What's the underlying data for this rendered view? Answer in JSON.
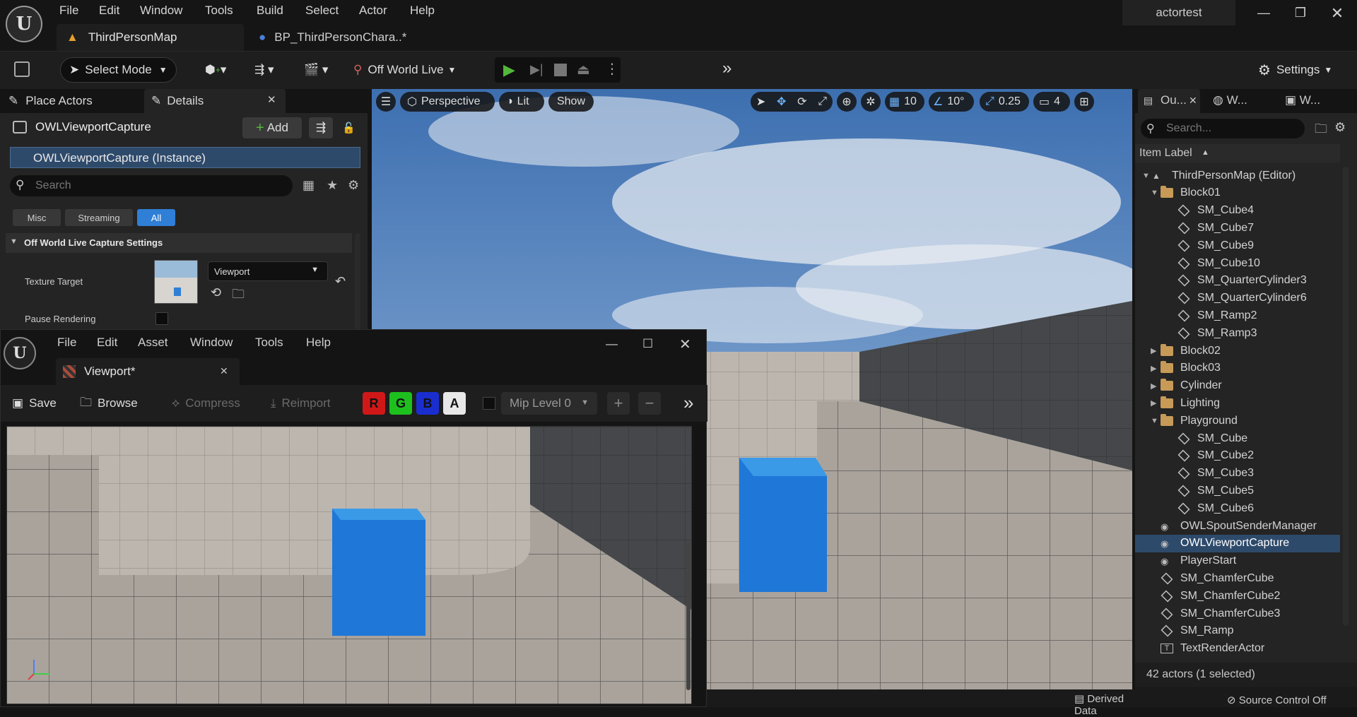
{
  "app": {
    "project_name": "actortest",
    "menus": [
      "File",
      "Edit",
      "Window",
      "Tools",
      "Build",
      "Select",
      "Actor",
      "Help"
    ],
    "tabs": [
      {
        "label": "ThirdPersonMap",
        "active": true
      },
      {
        "label": "BP_ThirdPersonChara..*",
        "active": false
      }
    ]
  },
  "toolbar": {
    "select_mode": "Select Mode",
    "off_world_live": "Off World Live",
    "settings": "Settings"
  },
  "left_panel": {
    "tab_place_actors": "Place Actors",
    "tab_details": "Details",
    "actor_name": "OWLViewportCapture",
    "add_button": "Add",
    "instance_row": "OWLViewportCapture (Instance)",
    "search_placeholder": "Search",
    "filters": [
      "Misc",
      "Streaming",
      "All"
    ],
    "section_title": "Off World Live Capture Settings",
    "texture_target_label": "Texture Target",
    "texture_target_value": "Viewport",
    "pause_rendering_label": "Pause Rendering"
  },
  "viewport": {
    "perspective": "Perspective",
    "lit": "Lit",
    "show": "Show",
    "grid_snap": "10",
    "rotation_snap": "10°",
    "scale_snap": "0.25",
    "camera_speed": "4"
  },
  "outliner": {
    "tabs": [
      "Ou...",
      "W...",
      "W..."
    ],
    "search_placeholder": "Search...",
    "column_header": "Item Label",
    "items": [
      {
        "label": "ThirdPersonMap (Editor)",
        "type": "map",
        "level": 0,
        "expanded": true
      },
      {
        "label": "Block01",
        "type": "folder",
        "level": 1,
        "expanded": true
      },
      {
        "label": "SM_Cube4",
        "type": "mesh",
        "level": 2
      },
      {
        "label": "SM_Cube7",
        "type": "mesh",
        "level": 2
      },
      {
        "label": "SM_Cube9",
        "type": "mesh",
        "level": 2
      },
      {
        "label": "SM_Cube10",
        "type": "mesh",
        "level": 2
      },
      {
        "label": "SM_QuarterCylinder3",
        "type": "mesh",
        "level": 2
      },
      {
        "label": "SM_QuarterCylinder6",
        "type": "mesh",
        "level": 2
      },
      {
        "label": "SM_Ramp2",
        "type": "mesh",
        "level": 2
      },
      {
        "label": "SM_Ramp3",
        "type": "mesh",
        "level": 2
      },
      {
        "label": "Block02",
        "type": "folder",
        "level": 1,
        "expanded": false
      },
      {
        "label": "Block03",
        "type": "folder",
        "level": 1,
        "expanded": false
      },
      {
        "label": "Cylinder",
        "type": "folder",
        "level": 1,
        "expanded": false
      },
      {
        "label": "Lighting",
        "type": "folder",
        "level": 1,
        "expanded": false
      },
      {
        "label": "Playground",
        "type": "folder",
        "level": 1,
        "expanded": true
      },
      {
        "label": "SM_Cube",
        "type": "mesh",
        "level": 2
      },
      {
        "label": "SM_Cube2",
        "type": "mesh",
        "level": 2
      },
      {
        "label": "SM_Cube3",
        "type": "mesh",
        "level": 2
      },
      {
        "label": "SM_Cube5",
        "type": "mesh",
        "level": 2
      },
      {
        "label": "SM_Cube6",
        "type": "mesh",
        "level": 2
      },
      {
        "label": "OWLSpoutSenderManager",
        "type": "actor",
        "level": 1
      },
      {
        "label": "OWLViewportCapture",
        "type": "actor",
        "level": 1,
        "selected": true
      },
      {
        "label": "PlayerStart",
        "type": "actor",
        "level": 1
      },
      {
        "label": "SM_ChamferCube",
        "type": "mesh",
        "level": 1
      },
      {
        "label": "SM_ChamferCube2",
        "type": "mesh",
        "level": 1
      },
      {
        "label": "SM_ChamferCube3",
        "type": "mesh",
        "level": 1
      },
      {
        "label": "SM_Ramp",
        "type": "mesh",
        "level": 1
      },
      {
        "label": "TextRenderActor",
        "type": "text",
        "level": 1
      }
    ],
    "footer": "42 actors (1 selected)"
  },
  "texture_window": {
    "menus": [
      "File",
      "Edit",
      "Asset",
      "Window",
      "Tools",
      "Help"
    ],
    "tab": "Viewport*",
    "save": "Save",
    "browse": "Browse",
    "compress": "Compress",
    "reimport": "Reimport",
    "channels": [
      "R",
      "G",
      "B",
      "A"
    ],
    "mip_level": "Mip Level 0"
  },
  "status_bar": {
    "derived_data": "Derived Data",
    "source_control": "Source Control Off"
  },
  "colors": {
    "accent_blue": "#2f7fd6",
    "selected_row": "#2e4a6b",
    "play_green": "#53b83a",
    "folder": "#c79a58"
  }
}
